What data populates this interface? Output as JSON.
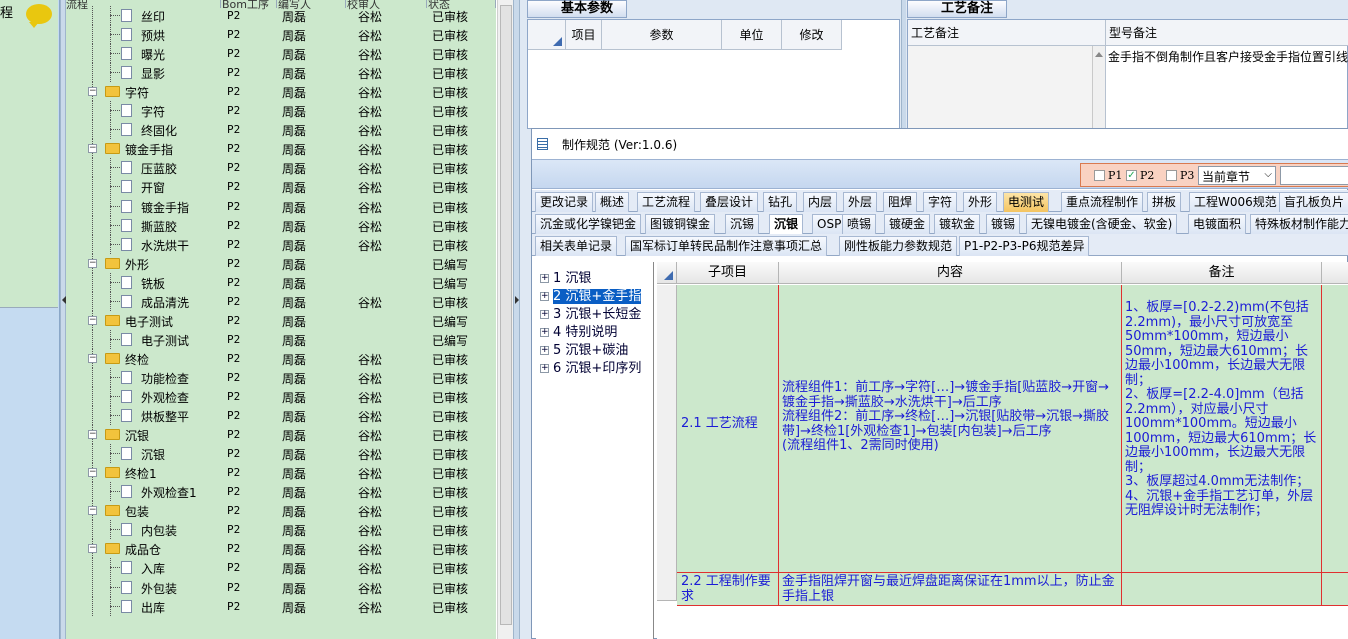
{
  "left_strip": {
    "label": "程"
  },
  "tree_header": {
    "col_process": "流程",
    "col_bom": "Bom工序",
    "col_editor": "编写人",
    "col_reviewer": "校审人",
    "col_status": "状态"
  },
  "tree_rows": [
    {
      "name": "丝印",
      "type": "leaf",
      "level": "P2",
      "editor": "周磊",
      "reviewer": "谷松",
      "status": "已审核"
    },
    {
      "name": "预烘",
      "type": "leaf",
      "level": "P2",
      "editor": "周磊",
      "reviewer": "谷松",
      "status": "已审核"
    },
    {
      "name": "曝光",
      "type": "leaf",
      "level": "P2",
      "editor": "周磊",
      "reviewer": "谷松",
      "status": "已审核"
    },
    {
      "name": "显影",
      "type": "leaf",
      "level": "P2",
      "editor": "周磊",
      "reviewer": "谷松",
      "status": "已审核"
    },
    {
      "name": "字符",
      "type": "folder",
      "level": "P2",
      "editor": "周磊",
      "reviewer": "谷松",
      "status": "已审核"
    },
    {
      "name": "字符",
      "type": "leaf",
      "level": "P2",
      "editor": "周磊",
      "reviewer": "谷松",
      "status": "已审核"
    },
    {
      "name": "终固化",
      "type": "leaf",
      "level": "P2",
      "editor": "周磊",
      "reviewer": "谷松",
      "status": "已审核"
    },
    {
      "name": "镀金手指",
      "type": "folder",
      "level": "P2",
      "editor": "周磊",
      "reviewer": "谷松",
      "status": "已审核"
    },
    {
      "name": "压蓝胶",
      "type": "leaf",
      "level": "P2",
      "editor": "周磊",
      "reviewer": "谷松",
      "status": "已审核"
    },
    {
      "name": "开窗",
      "type": "leaf",
      "level": "P2",
      "editor": "周磊",
      "reviewer": "谷松",
      "status": "已审核"
    },
    {
      "name": "镀金手指",
      "type": "leaf",
      "level": "P2",
      "editor": "周磊",
      "reviewer": "谷松",
      "status": "已审核"
    },
    {
      "name": "撕蓝胶",
      "type": "leaf",
      "level": "P2",
      "editor": "周磊",
      "reviewer": "谷松",
      "status": "已审核"
    },
    {
      "name": "水洗烘干",
      "type": "leaf",
      "level": "P2",
      "editor": "周磊",
      "reviewer": "谷松",
      "status": "已审核"
    },
    {
      "name": "外形",
      "type": "folder",
      "level": "P2",
      "editor": "周磊",
      "reviewer": "",
      "status": "已编写"
    },
    {
      "name": "铣板",
      "type": "leaf",
      "level": "P2",
      "editor": "周磊",
      "reviewer": "",
      "status": "已编写"
    },
    {
      "name": "成品清洗",
      "type": "leaf",
      "level": "P2",
      "editor": "周磊",
      "reviewer": "谷松",
      "status": "已审核"
    },
    {
      "name": "电子测试",
      "type": "folder",
      "level": "P2",
      "editor": "周磊",
      "reviewer": "",
      "status": "已编写"
    },
    {
      "name": "电子测试",
      "type": "leaf",
      "level": "P2",
      "editor": "周磊",
      "reviewer": "",
      "status": "已编写"
    },
    {
      "name": "终检",
      "type": "folder",
      "level": "P2",
      "editor": "周磊",
      "reviewer": "谷松",
      "status": "已审核"
    },
    {
      "name": "功能检查",
      "type": "leaf",
      "level": "P2",
      "editor": "周磊",
      "reviewer": "谷松",
      "status": "已审核"
    },
    {
      "name": "外观检查",
      "type": "leaf",
      "level": "P2",
      "editor": "周磊",
      "reviewer": "谷松",
      "status": "已审核"
    },
    {
      "name": "烘板整平",
      "type": "leaf",
      "level": "P2",
      "editor": "周磊",
      "reviewer": "谷松",
      "status": "已审核"
    },
    {
      "name": "沉银",
      "type": "folder",
      "level": "P2",
      "editor": "周磊",
      "reviewer": "谷松",
      "status": "已审核"
    },
    {
      "name": "沉银",
      "type": "leaf",
      "level": "P2",
      "editor": "周磊",
      "reviewer": "谷松",
      "status": "已审核"
    },
    {
      "name": "终检1",
      "type": "folder",
      "level": "P2",
      "editor": "周磊",
      "reviewer": "谷松",
      "status": "已审核"
    },
    {
      "name": "外观检查1",
      "type": "leaf",
      "level": "P2",
      "editor": "周磊",
      "reviewer": "谷松",
      "status": "已审核"
    },
    {
      "name": "包装",
      "type": "folder",
      "level": "P2",
      "editor": "周磊",
      "reviewer": "谷松",
      "status": "已审核"
    },
    {
      "name": "内包装",
      "type": "leaf",
      "level": "P2",
      "editor": "周磊",
      "reviewer": "谷松",
      "status": "已审核"
    },
    {
      "name": "成品仓",
      "type": "folder",
      "level": "P2",
      "editor": "周磊",
      "reviewer": "谷松",
      "status": "已审核"
    },
    {
      "name": "入库",
      "type": "leaf",
      "level": "P2",
      "editor": "周磊",
      "reviewer": "谷松",
      "status": "已审核"
    },
    {
      "name": "外包装",
      "type": "leaf",
      "level": "P2",
      "editor": "周磊",
      "reviewer": "谷松",
      "status": "已审核"
    },
    {
      "name": "出库",
      "type": "leaf",
      "level": "P2",
      "editor": "周磊",
      "reviewer": "谷松",
      "status": "已审核"
    }
  ],
  "basic_params": {
    "tab": "基本参数",
    "cols": [
      "项目",
      "参数",
      "单位",
      "修改"
    ]
  },
  "process_notes": {
    "tab": "工艺备注",
    "col_process_note": "工艺备注",
    "col_model_note": "型号备注",
    "model_note_text": "金手指不倒角制作且客户接受金手指位置引线"
  },
  "dialog": {
    "title": "制作规范 (Ver:1.0.6)",
    "checkboxes": [
      {
        "label": "P1",
        "checked": false
      },
      {
        "label": "P2",
        "checked": true
      },
      {
        "label": "P3",
        "checked": false
      }
    ],
    "chapter_select": "当前章节",
    "tabs_row1": [
      "更改记录",
      "概述",
      "工艺流程",
      "叠层设计",
      "钻孔",
      "内层",
      "外层",
      "阻焊",
      "字符",
      "外形",
      "电测试",
      "重点流程制作",
      "拼板",
      "工程W006规范",
      "盲孔板负片"
    ],
    "tabs_row2": [
      "沉金或化学镍钯金",
      "图镀铜镍金",
      "沉锡",
      "沉银",
      "OSP",
      "喷锡",
      "镀硬金",
      "镀软金",
      "镀锡",
      "无镍电镀金(含硬金、软金)",
      "电镀面积",
      "特殊板材制作能力"
    ],
    "tabs_row3": [
      "相关表单记录",
      "国军标订单转民品制作注意事项汇总",
      "刚性板能力参数规范",
      "P1-P2-P3-P6规范差异"
    ],
    "nav_tree": [
      {
        "num": "1",
        "label": "沉银",
        "selected": false
      },
      {
        "num": "2",
        "label": "沉银+金手指",
        "selected": true
      },
      {
        "num": "3",
        "label": "沉银+长短金",
        "selected": false
      },
      {
        "num": "4",
        "label": "特别说明",
        "selected": false
      },
      {
        "num": "5",
        "label": "沉银+碳油",
        "selected": false
      },
      {
        "num": "6",
        "label": "沉银+印序列",
        "selected": false
      }
    ],
    "grid_header": {
      "sub": "子项目",
      "content": "内容",
      "remark": "备注"
    },
    "grid_rows": [
      {
        "sub": "2.1 工艺流程",
        "content": "流程组件1：前工序→字符[…]→镀金手指[贴蓝胶→开窗→镀金手指→撕蓝胶→水洗烘干]→后工序\n流程组件2：前工序→终检[…]→沉银[贴胶带→沉银→撕胶带]→终检1[外观检查1]→包装[内包装]→后工序\n(流程组件1、2需同时使用)",
        "remark": "1、板厚=[0.2-2.2)mm(不包括2.2mm)，最小尺寸可放宽至50mm*100mm，短边最小50mm，短边最大610mm；长边最小100mm，长边最大无限制；\n2、板厚=[2.2-4.0]mm（包括2.2mm），对应最小尺寸100mm*100mm。短边最小100mm，短边最大610mm；长边最小100mm，长边最大无限制；\n3、板厚超过4.0mm无法制作；\n4、沉银+金手指工艺订单，外层无阻焊设计时无法制作；"
      },
      {
        "sub": "2.2 工程制作要求",
        "content": "金手指阻焊开窗与最近焊盘距离保证在1mm以上，防止金手指上银",
        "remark": ""
      }
    ]
  }
}
